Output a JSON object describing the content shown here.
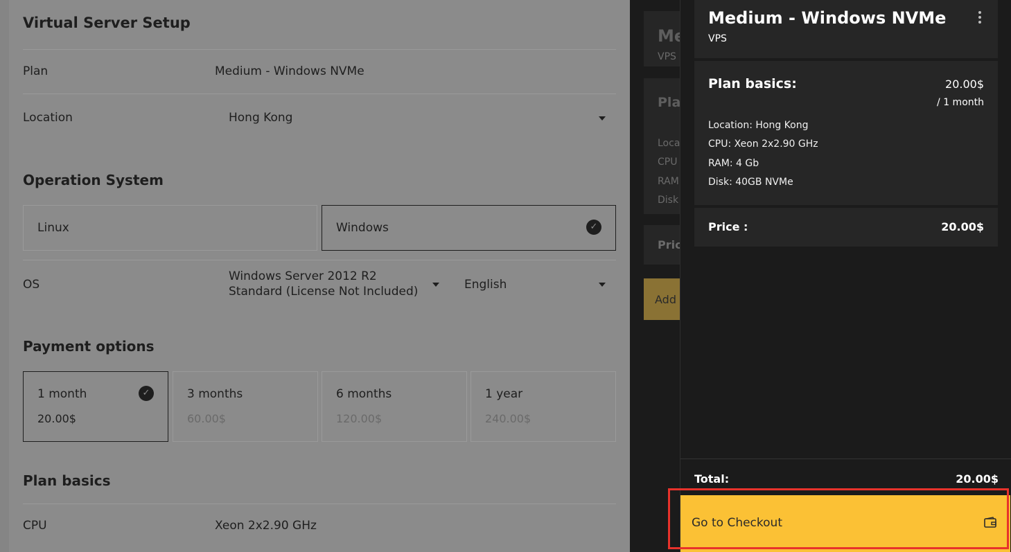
{
  "setup": {
    "title": "Virtual Server Setup",
    "plan_label": "Plan",
    "plan_value": "Medium - Windows NVMe",
    "location_label": "Location",
    "location_value": "Hong Kong",
    "os_section_title": "Operation System",
    "os_options": [
      {
        "label": "Linux",
        "selected": false
      },
      {
        "label": "Windows",
        "selected": true
      }
    ],
    "os_label": "OS",
    "os_version_line1": "Windows Server 2012 R2",
    "os_version_line2": "Standard (License Not Included)",
    "language_value": "English",
    "payment_title": "Payment options",
    "payment_options": [
      {
        "term": "1 month",
        "price": "20.00$",
        "selected": true
      },
      {
        "term": "3 months",
        "price": "60.00$",
        "selected": false
      },
      {
        "term": "6 months",
        "price": "120.00$",
        "selected": false
      },
      {
        "term": "1 year",
        "price": "240.00$",
        "selected": false
      }
    ],
    "plan_basics_title": "Plan basics",
    "cpu_label": "CPU",
    "cpu_value": "Xeon 2x2.90 GHz"
  },
  "background_panel": {
    "title_partial": "Me",
    "type_partial": "VPS",
    "basics_partial": "Pla",
    "spec_partials": [
      "Loca",
      "CPU",
      "RAM",
      "Disk"
    ],
    "price_partial": "Pric",
    "add_partial": "Add"
  },
  "cart": {
    "plan_name": "Medium - Windows NVMe",
    "plan_type": "VPS",
    "basics_title": "Plan basics:",
    "basics_price": "20.00$",
    "basics_period": "/ 1 month",
    "specs": [
      "Location: Hong Kong",
      "CPU: Xeon 2x2.90 GHz",
      "RAM: 4 Gb",
      "Disk: 40GB NVMe"
    ],
    "price_label": "Price :",
    "price_value": "20.00$",
    "total_label": "Total:",
    "total_value": "20.00$",
    "checkout_label": "Go to Checkout"
  },
  "icons": {
    "check": "check-circle-icon",
    "caret": "caret-down-icon",
    "kebab": "kebab-menu-icon",
    "wallet": "wallet-icon"
  },
  "colors": {
    "accent": "#fbc135",
    "highlight": "#e8322b",
    "drawer_bg": "#1b1b1b",
    "card_bg": "#262626"
  }
}
